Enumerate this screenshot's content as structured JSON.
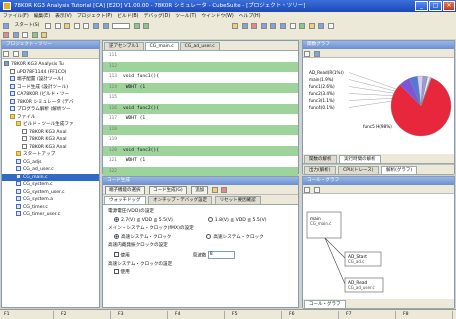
{
  "window": {
    "title": "78K0R KG3 Analysis Tutorial [CA] [E2D] V1.00.00 - 78K0R シミュレータ - CubeSuite - [プロジェクト・ツリー]",
    "min": "_",
    "max": "□",
    "close": "×"
  },
  "menubar": [
    "ファイル(F)",
    "編集(E)",
    "表示(V)",
    "プロジェクト(P)",
    "ビルド(B)",
    "デバッグ(D)",
    "ツール(T)",
    "ウインドウ(W)",
    "ヘルプ(H)"
  ],
  "toolbar": {
    "start_label": "スタート(S)"
  },
  "project_tree": {
    "title": "プロジェクト・ツリー",
    "items": [
      {
        "depth": 0,
        "icon": "proj",
        "text": "78K0R KG3 Analysis Tu"
      },
      {
        "depth": 1,
        "icon": "file",
        "text": "uPD78F1144 (FF1CO)"
      },
      {
        "depth": 1,
        "icon": "c",
        "text": "端子配置 (設計ツール)"
      },
      {
        "depth": 1,
        "icon": "c",
        "text": "コード生成 (設計ツール)"
      },
      {
        "depth": 1,
        "icon": "c",
        "text": "CA78K0R (ビルド・ツー"
      },
      {
        "depth": 1,
        "icon": "c",
        "text": "78K0R シミュレータ (デバ"
      },
      {
        "depth": 1,
        "icon": "c",
        "text": "プログラム解析 (解析ツー"
      },
      {
        "depth": 1,
        "icon": "folder",
        "text": "ファイル"
      },
      {
        "depth": 2,
        "icon": "folder",
        "text": "ビルド・ツール生成ファ"
      },
      {
        "depth": 3,
        "icon": "file",
        "text": "78K0R KG3 Anal"
      },
      {
        "depth": 3,
        "icon": "file",
        "text": "78K0R KG3 Anal"
      },
      {
        "depth": 3,
        "icon": "file",
        "text": "78K0R KG3 Anal"
      },
      {
        "depth": 2,
        "icon": "folder",
        "text": "スタートアップ"
      },
      {
        "depth": 2,
        "icon": "c",
        "text": "CG_adjs"
      },
      {
        "depth": 2,
        "icon": "c",
        "text": "CG_ad_user.c"
      },
      {
        "depth": 2,
        "icon": "c",
        "text": "CG_main.c"
      },
      {
        "depth": 2,
        "icon": "c",
        "text": "CG_system.c"
      },
      {
        "depth": 2,
        "icon": "c",
        "text": "CG_system_user.c"
      },
      {
        "depth": 2,
        "icon": "c",
        "text": "CG_system.a"
      },
      {
        "depth": 2,
        "icon": "c",
        "text": "CG_timer.c"
      },
      {
        "depth": 2,
        "icon": "c",
        "text": "CG_timer_user.c"
      }
    ],
    "selected_index": 15
  },
  "editor": {
    "tabs": [
      "逆アセンブル1",
      "CG_main.c",
      "CG_ad_user.c"
    ],
    "active_tab": 1,
    "lines": [
      {
        "ln": "111",
        "text": "",
        "hl": false
      },
      {
        "ln": "112",
        "text": "",
        "hl": true
      },
      {
        "ln": "113",
        "text": "void    func1(){",
        "hl": false
      },
      {
        "ln": "114",
        "text": "        WDHT (1",
        "hl": true
      },
      {
        "ln": "115",
        "text": "",
        "hl": false
      },
      {
        "ln": "116",
        "text": "void    func2(){",
        "hl": true
      },
      {
        "ln": "117",
        "text": "        WDHT (1",
        "hl": false
      },
      {
        "ln": "118",
        "text": "",
        "hl": true
      },
      {
        "ln": "119",
        "text": "",
        "hl": false
      },
      {
        "ln": "120",
        "text": "void    func3(){",
        "hl": true
      },
      {
        "ln": "121",
        "text": "        WDHT (1",
        "hl": false
      },
      {
        "ln": "122",
        "text": "",
        "hl": true
      }
    ]
  },
  "code_gen": {
    "title": "コード生成",
    "toolbar": [
      "端子機能の選択",
      "コード生成(G)",
      "追加"
    ],
    "tabs": [
      "ウォッチドッグ",
      "オンチップ・デバッグ設定",
      "リセット要因確認"
    ],
    "section1": "電源電圧(VDD)の設定",
    "opt1": "2.7(V) ≦ VDD ≦ 5.5(V)",
    "opt2": "1.8(V) ≦ VDD ≦ 5.5(V)",
    "section2": "メイン・システム・クロック(fMX)の設定",
    "opt3": "高速システム・クロック",
    "opt4": "高速システム・クロック",
    "section3": "高速内蔵発振クロックの設定",
    "opt5": "使用",
    "freq_label": "周波数",
    "freq_value": "8",
    "section4": "高速システム・クロックの設定",
    "opt6": "使用"
  },
  "pie_panel": {
    "title": "関数グラフ",
    "tabs": [
      "関数の解析",
      "実行時間の解析"
    ],
    "lower_tabs": [
      "出力(解析)",
      "CPU(トレース)",
      "解析(グラフ)"
    ],
    "legend": [
      "AD_Read(R(1%))",
      "main(1.9%)",
      "func1(2.6%)",
      "func2(3.4%)",
      "func3(1.1%)",
      "func4(0.1%)",
      "func5 H(98%)"
    ]
  },
  "chart_data": {
    "type": "pie",
    "categories": [
      "func5 H",
      "func3",
      "func2",
      "func1",
      "main",
      "AD_Read",
      "func4"
    ],
    "values": [
      82,
      6,
      4.5,
      3,
      2.5,
      1.5,
      0.5
    ],
    "colors": [
      "#e8273c",
      "#7d55d8",
      "#5577d8",
      "#d6d0f0",
      "#9a9ad8",
      "#f0f0f0",
      "#c8c8f0"
    ]
  },
  "call_graph": {
    "title": "コール・グラフ",
    "nodes": [
      {
        "id": "main",
        "label": "main",
        "sub": "CG_main.c"
      },
      {
        "id": "n2",
        "label": "AD_Start",
        "sub": "CG_ad.c"
      },
      {
        "id": "n3",
        "label": "AD_Read",
        "sub": "CG_ad_user.c"
      }
    ],
    "bottom_tab": "コール・グラフ"
  },
  "fkeys": [
    "F1",
    "F2",
    "F3",
    "F4",
    "F5",
    "F6",
    "F7",
    "F8"
  ]
}
